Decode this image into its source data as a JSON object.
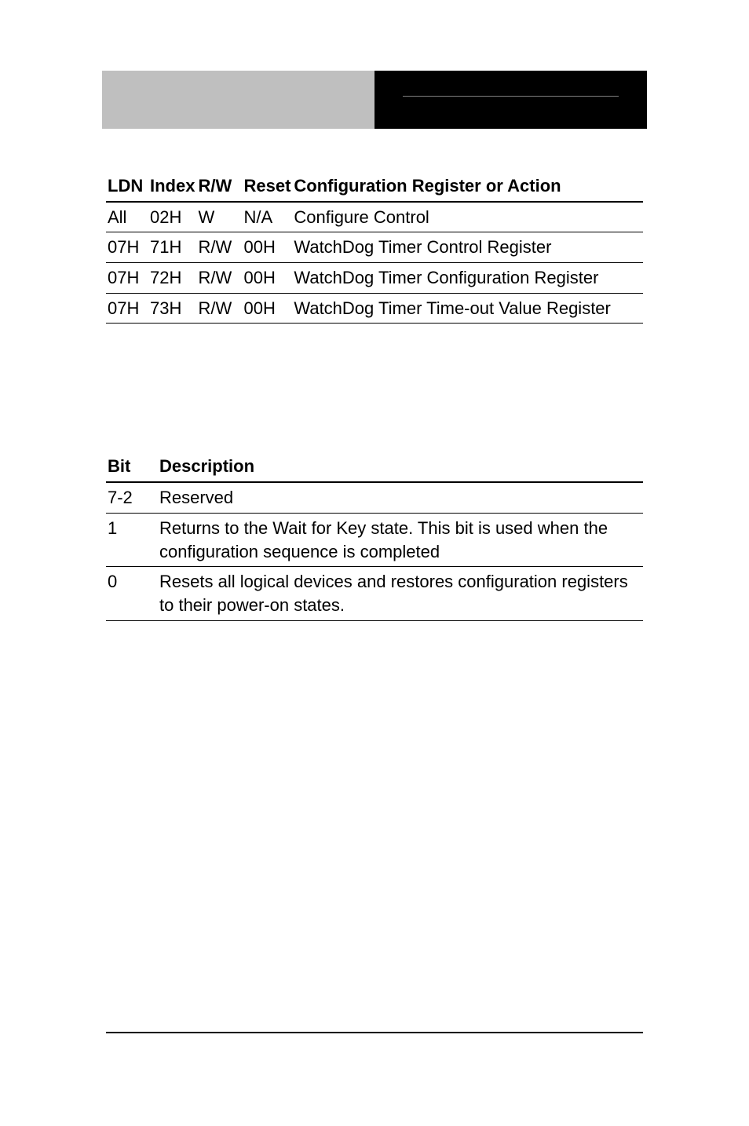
{
  "table1": {
    "headers": {
      "ldn": "LDN",
      "index": "Index",
      "rw": "R/W",
      "reset": "Reset",
      "desc": "Configuration Register or Action"
    },
    "rows": [
      {
        "ldn": "All",
        "index": "02H",
        "rw": "W",
        "reset": "N/A",
        "desc": "Configure Control"
      },
      {
        "ldn": "07H",
        "index": "71H",
        "rw": "R/W",
        "reset": "00H",
        "desc": "WatchDog Timer Control Register"
      },
      {
        "ldn": "07H",
        "index": "72H",
        "rw": "R/W",
        "reset": "00H",
        "desc": "WatchDog Timer Configuration Register"
      },
      {
        "ldn": "07H",
        "index": "73H",
        "rw": "R/W",
        "reset": "00H",
        "desc": "WatchDog Timer Time-out Value Register"
      }
    ]
  },
  "table2": {
    "headers": {
      "bit": "Bit",
      "desc": "Description"
    },
    "rows": [
      {
        "bit": "7-2",
        "desc": "Reserved"
      },
      {
        "bit": "1",
        "desc": "Returns to the Wait for Key state. This bit is used when the configuration sequence is completed"
      },
      {
        "bit": "0",
        "desc": "Resets all logical devices and restores configuration registers to their power-on states."
      }
    ]
  }
}
